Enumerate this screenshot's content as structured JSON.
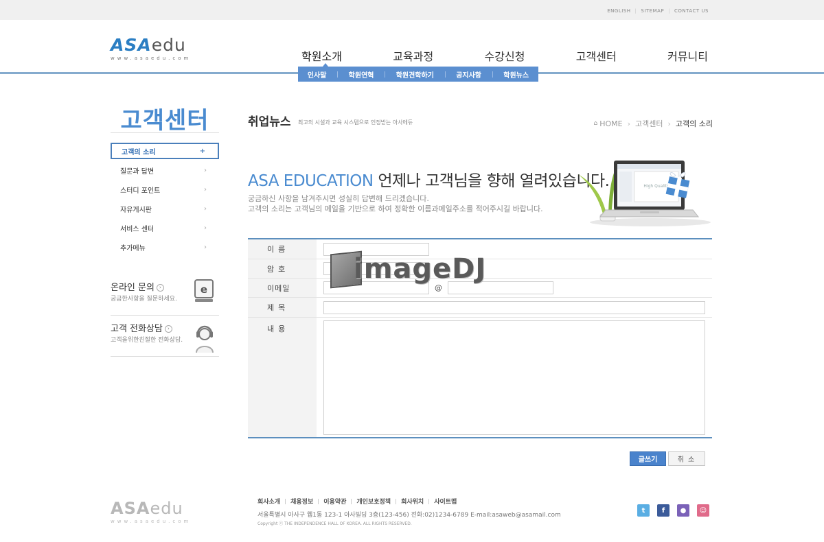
{
  "utility_links": [
    "ENGLISH",
    "SITEMAP",
    "CONTACT US"
  ],
  "logo": {
    "asa": "ASA",
    "edu": "edu",
    "url": "www.asaedu.com"
  },
  "main_nav": [
    "학원소개",
    "교육과정",
    "수강신청",
    "고객센터",
    "커뮤니티"
  ],
  "sub_nav": [
    "인사말",
    "학원연혁",
    "학원견학하기",
    "공지사항",
    "학원뉴스"
  ],
  "sidebar": {
    "title": "고객센터",
    "menu": [
      {
        "label": "고객의 소리",
        "arrow": "+"
      },
      {
        "label": "질문과 답변",
        "arrow": "›"
      },
      {
        "label": "스터디 포인트",
        "arrow": "›"
      },
      {
        "label": "자유게시판",
        "arrow": "›"
      },
      {
        "label": "서비스 센터",
        "arrow": "›"
      },
      {
        "label": "추가메뉴",
        "arrow": "›"
      }
    ],
    "promo_online": {
      "title": "온라인 문의",
      "desc": "궁금한사항을 질문하세요."
    },
    "promo_phone": {
      "title": "고객 전화상담",
      "desc": "고객을위한친절한 전화상담."
    }
  },
  "content": {
    "title": "취업뉴스",
    "subtitle": "최고의 시설과 교육 시스템으로 인정받는 아사에듀",
    "breadcrumb": {
      "home": "HOME",
      "section": "고객센터",
      "current": "고객의 소리"
    },
    "banner": {
      "heading_accent": "ASA EDUCATION",
      "heading_rest": " 언제나 고객님을 향해 열려있습니다.",
      "line1": "궁금하신 사항을 남겨주시면 성실히 답변해 드리겠습니다.",
      "line2": "고객의 소리는 고객님의 메일을 기반으로 하여 정확한 이름과메일주소를 적어주시길 바랍니다.",
      "screen_text": "High Quality"
    }
  },
  "form": {
    "name_label": "이름",
    "password_label": "암호",
    "email_label": "이메일",
    "email_at": "@",
    "subject_label": "제목",
    "content_label": "내용"
  },
  "buttons": {
    "submit": "글쓰기",
    "cancel": "취소"
  },
  "watermark": "imageDJ",
  "footer": {
    "logo_asa": "ASA",
    "logo_edu": "edu",
    "logo_url": "www.asaedu.com",
    "links": [
      "회사소개",
      "채용정보",
      "이용약관",
      "개인보호정책",
      "회사위치",
      "사이트맵"
    ],
    "address": "서울특별시 아사구 웹1동 123-1 아사빌딩 3층(123-456) 전화:02)1234-6789 E-mail:asaweb@asamail.com",
    "copyright": "Copyright ⓒ THE INDEPENDENCE HALL OF KOREA. ALL RIGHTS RESERVED."
  },
  "colors": {
    "accent": "#4a8bd0",
    "nav_line": "#5c8fbe",
    "sub_nav_bg": "#5b8fd0"
  }
}
